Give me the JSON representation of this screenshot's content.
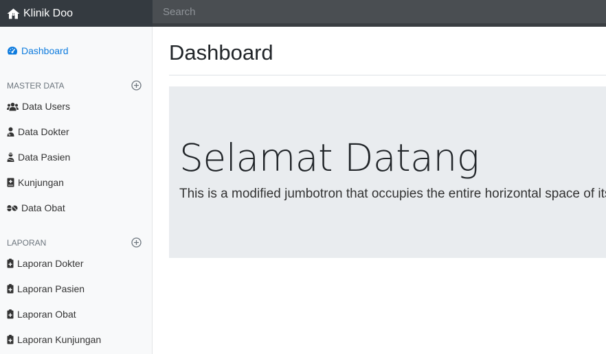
{
  "brand": {
    "name": "Klinik Doo",
    "icon": "home-icon"
  },
  "search": {
    "placeholder": "Search"
  },
  "sidebar": {
    "dashboard": {
      "label": "Dashboard",
      "icon": "tachometer-icon"
    },
    "sections": [
      {
        "title": "MASTER DATA",
        "action_icon": "plus-circle-icon",
        "items": [
          {
            "label": "Data Users",
            "icon": "users-icon"
          },
          {
            "label": "Data Dokter",
            "icon": "user-doctor-icon"
          },
          {
            "label": "Data Pasien",
            "icon": "user-injured-icon"
          },
          {
            "label": "Kunjungan",
            "icon": "medical-notes-icon"
          },
          {
            "label": "Data Obat",
            "icon": "pills-icon"
          }
        ]
      },
      {
        "title": "LAPORAN",
        "action_icon": "plus-circle-icon",
        "items": [
          {
            "label": "Laporan Dokter",
            "icon": "clipboard-medical-icon"
          },
          {
            "label": "Laporan Pasien",
            "icon": "clipboard-medical-icon"
          },
          {
            "label": "Laporan Obat",
            "icon": "clipboard-medical-icon"
          },
          {
            "label": "Laporan Kunjungan",
            "icon": "clipboard-medical-icon"
          }
        ]
      }
    ]
  },
  "main": {
    "title": "Dashboard",
    "jumbotron": {
      "heading": "Selamat Datang",
      "lead": "This is a modified jumbotron that occupies the entire horizontal space of its"
    }
  },
  "colors": {
    "active": "#0d7bde",
    "topbar": "#343a40",
    "jumbotron": "#e9ecef"
  }
}
